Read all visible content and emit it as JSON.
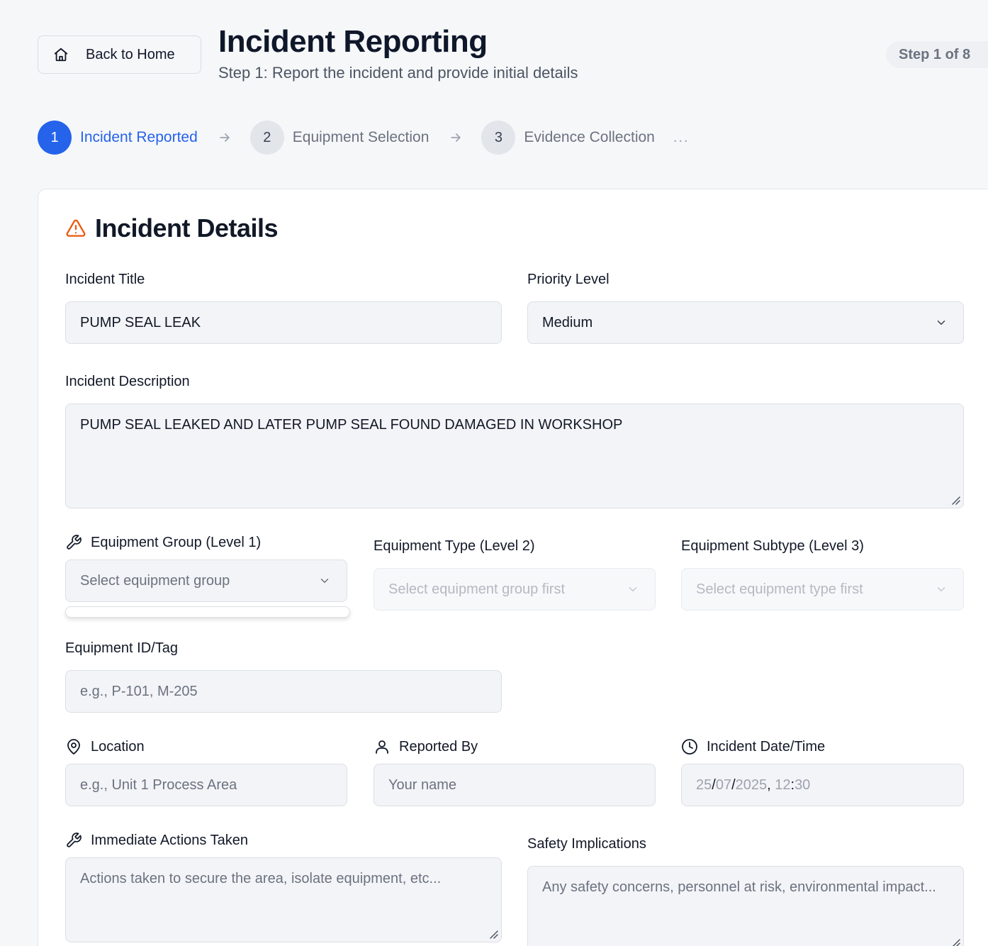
{
  "header": {
    "back_label": "Back to Home",
    "title": "Incident Reporting",
    "subtitle": "Step 1: Report the incident and provide initial details",
    "step_indicator": "Step 1 of 8"
  },
  "stepper": {
    "steps": [
      {
        "number": "1",
        "label": "Incident Reported",
        "active": true
      },
      {
        "number": "2",
        "label": "Equipment Selection",
        "active": false
      },
      {
        "number": "3",
        "label": "Evidence Collection",
        "active": false
      }
    ],
    "more": "..."
  },
  "form": {
    "section_title": "Incident Details",
    "incident_title": {
      "label": "Incident Title",
      "value": "PUMP SEAL LEAK"
    },
    "priority": {
      "label": "Priority Level",
      "value": "Medium"
    },
    "description": {
      "label": "Incident Description",
      "value": "PUMP SEAL LEAKED AND LATER PUMP SEAL FOUND DAMAGED IN WORKSHOP"
    },
    "equipment_group": {
      "label": "Equipment Group (Level 1)",
      "placeholder": "Select equipment group"
    },
    "equipment_type": {
      "label": "Equipment Type (Level 2)",
      "placeholder": "Select equipment group first"
    },
    "equipment_subtype": {
      "label": "Equipment Subtype (Level 3)",
      "placeholder": "Select equipment type first"
    },
    "equipment_id": {
      "label": "Equipment ID/Tag",
      "placeholder": "e.g., P-101, M-205"
    },
    "location": {
      "label": "Location",
      "placeholder": "e.g., Unit 1 Process Area"
    },
    "reported_by": {
      "label": "Reported By",
      "placeholder": "Your name"
    },
    "incident_datetime": {
      "label": "Incident Date/Time",
      "day": "25",
      "month": "07",
      "year": "2025",
      "hour": "12",
      "minute": "30"
    },
    "immediate_actions": {
      "label": "Immediate Actions Taken",
      "placeholder": "Actions taken to secure the area, isolate equipment, etc..."
    },
    "safety_implications": {
      "label": "Safety Implications",
      "placeholder": "Any safety concerns, personnel at risk, environmental impact..."
    }
  },
  "colors": {
    "accent": "#2563eb",
    "warning_icon": "#ea580c",
    "background": "#f6f7f9"
  },
  "icons": [
    "home-icon",
    "arrow-right-icon",
    "alert-triangle-icon",
    "chevron-down-icon",
    "wrench-icon",
    "map-pin-icon",
    "user-icon",
    "clock-icon"
  ]
}
